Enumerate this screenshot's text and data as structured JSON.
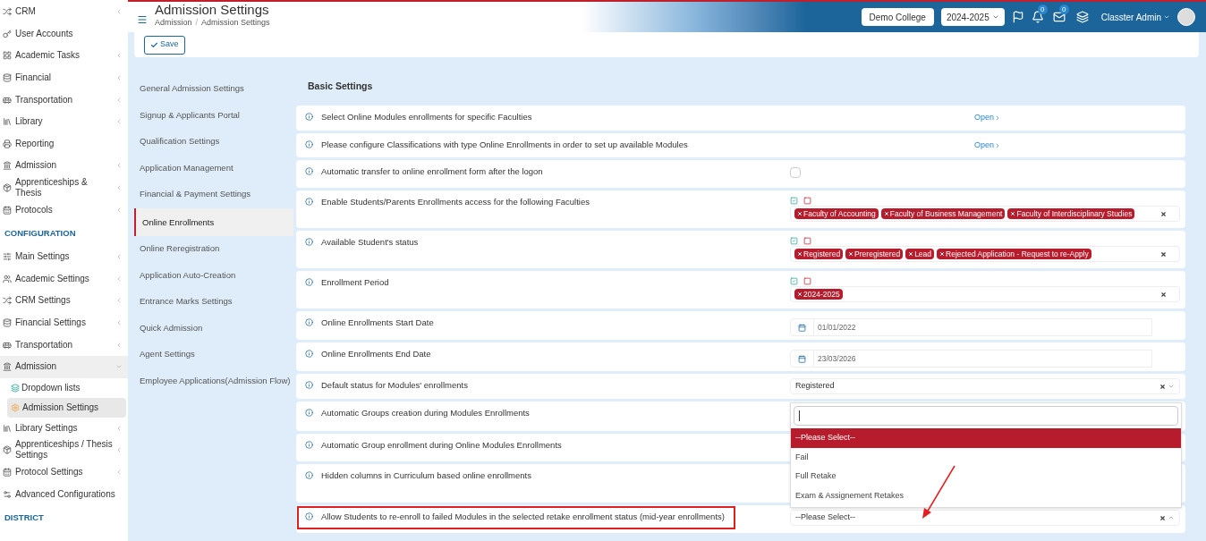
{
  "sidebar": {
    "sections": [
      {
        "items": [
          {
            "label": "CRM",
            "expandable": true,
            "expanded": false,
            "selected": false
          },
          {
            "label": "User Accounts",
            "expandable": false,
            "expanded": false,
            "selected": false
          },
          {
            "label": "Academic Tasks",
            "expandable": true,
            "expanded": false,
            "selected": false
          },
          {
            "label": "Financial",
            "expandable": true,
            "expanded": false,
            "selected": false
          },
          {
            "label": "Transportation",
            "expandable": true,
            "expanded": false,
            "selected": false
          },
          {
            "label": "Library",
            "expandable": true,
            "expanded": false,
            "selected": false
          },
          {
            "label": "Reporting",
            "expandable": false,
            "expanded": false,
            "selected": false
          },
          {
            "label": "Admission",
            "expandable": true,
            "expanded": false,
            "selected": false
          },
          {
            "label": "Apprenticeships & Thesis",
            "expandable": true,
            "expanded": false,
            "selected": false
          },
          {
            "label": "Protocols",
            "expandable": true,
            "expanded": false,
            "selected": false
          }
        ]
      },
      {
        "heading": "CONFIGURATION",
        "items": [
          {
            "label": "Main Settings",
            "expandable": true,
            "expanded": false,
            "selected": false
          },
          {
            "label": "Academic Settings",
            "expandable": true,
            "expanded": false,
            "selected": false
          },
          {
            "label": "CRM Settings",
            "expandable": true,
            "expanded": false,
            "selected": false
          },
          {
            "label": "Financial Settings",
            "expandable": true,
            "expanded": false,
            "selected": false
          },
          {
            "label": "Transportation",
            "expandable": true,
            "expanded": false,
            "selected": false
          },
          {
            "label": "Admission",
            "expandable": true,
            "expanded": true,
            "selected": false,
            "children": [
              {
                "label": "Dropdown lists",
                "selected": false
              },
              {
                "label": "Admission Settings",
                "selected": true
              }
            ]
          },
          {
            "label": "Library Settings",
            "expandable": true,
            "expanded": false,
            "selected": false
          },
          {
            "label": "Apprenticeships / Thesis Settings",
            "expandable": true,
            "expanded": false,
            "selected": false
          },
          {
            "label": "Protocol Settings",
            "expandable": true,
            "expanded": false,
            "selected": false
          },
          {
            "label": "Advanced Configurations",
            "expandable": false,
            "expanded": false,
            "selected": false
          }
        ]
      },
      {
        "heading": "DISTRICT"
      }
    ]
  },
  "header": {
    "title": "Admission Settings",
    "breadcrumb": [
      "Admission",
      "Admission Settings"
    ],
    "breadcrumb_separator": "/",
    "school": "Demo College",
    "year": "2024-2025",
    "notifications": "0",
    "messages": "0",
    "user": "Classter Admin"
  },
  "toolbar": {
    "save": "Save"
  },
  "settings_menu": [
    {
      "label": "General Admission Settings",
      "selected": false
    },
    {
      "label": "Signup & Applicants Portal",
      "selected": false
    },
    {
      "label": "Qualification Settings",
      "selected": false
    },
    {
      "label": "Application Management",
      "selected": false
    },
    {
      "label": "Financial & Payment Settings",
      "selected": false
    },
    {
      "label": "Online Enrollments",
      "selected": true
    },
    {
      "label": "Online Reregistration",
      "selected": false
    },
    {
      "label": "Application Auto-Creation",
      "selected": false
    },
    {
      "label": "Entrance Marks Settings",
      "selected": false
    },
    {
      "label": "Quick Admission",
      "selected": false
    },
    {
      "label": "Agent Settings",
      "selected": false
    },
    {
      "label": "Employee Applications(Admission Flow)",
      "selected": false
    }
  ],
  "section_title": "Basic Settings",
  "rows": [
    {
      "kind": "link",
      "label": "Select Online Modules enrollments for specific Faculties",
      "link": "Open"
    },
    {
      "kind": "link",
      "label": "Please configure Classifications with type Online Enrollments in order to set up available Modules",
      "link": "Open"
    },
    {
      "kind": "checkbox",
      "label": "Automatic transfer to online enrollment form after the logon",
      "checked": false
    },
    {
      "kind": "tags",
      "label": "Enable Students/Parents Enrollments access for the following Faculties",
      "tags": [
        "Faculty of Accounting",
        "Faculty of Business Management",
        "Faculty of Interdisciplinary Studies"
      ]
    },
    {
      "kind": "tags",
      "label": "Available Student's status",
      "tags": [
        "Registered",
        "Preregistered",
        "Lead",
        "Rejected Application - Request to re-Apply"
      ]
    },
    {
      "kind": "tags",
      "label": "Enrollment Period",
      "tags": [
        "2024-2025"
      ]
    },
    {
      "kind": "date",
      "label": "Online Enrollments Start Date",
      "value": "01/01/2022"
    },
    {
      "kind": "date",
      "label": "Online Enrollments End Date",
      "value": "23/03/2026"
    },
    {
      "kind": "select",
      "label": "Default status for Modules' enrollments",
      "value": "Registered",
      "open": false
    },
    {
      "kind": "covered",
      "label": "Automatic Groups creation during Modules Enrollments"
    },
    {
      "kind": "covered",
      "label": "Automatic Group enrollment during Online Modules Enrollments"
    },
    {
      "kind": "covered",
      "label": "Hidden columns in Curriculum based online enrollments"
    },
    {
      "kind": "select",
      "label": "Allow Students to re-enroll to failed Modules in the selected retake enrollment status (mid-year enrollments)",
      "value": "--Please Select--",
      "open": true,
      "highlighted": true,
      "options": [
        {
          "label": "--Please Select--",
          "selected": true
        },
        {
          "label": "Fail",
          "selected": false
        },
        {
          "label": "Full Retake",
          "selected": false
        },
        {
          "label": "Exam & Assignement Retakes",
          "selected": false
        }
      ]
    }
  ]
}
